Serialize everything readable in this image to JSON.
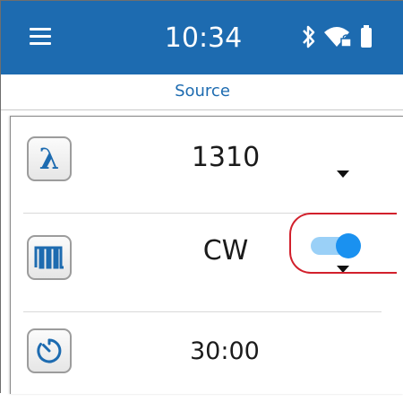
{
  "status_bar": {
    "time": "10:34",
    "icons": [
      "menu-icon",
      "bluetooth-icon",
      "wifi-locked-icon",
      "battery-icon"
    ],
    "color": "#1d6bb0"
  },
  "tab": {
    "label": "Source"
  },
  "settings": {
    "wavelength": {
      "icon": "lambda-icon",
      "icon_glyph": "λ",
      "value": "1310"
    },
    "modulation": {
      "icon": "square-wave-icon",
      "value": "CW"
    },
    "timer": {
      "icon": "timer-icon",
      "value": "30:00",
      "enabled": true
    }
  },
  "colors": {
    "accent": "#1d6bb0",
    "toggle_on": "#1a91f0",
    "highlight": "#d2202c"
  }
}
